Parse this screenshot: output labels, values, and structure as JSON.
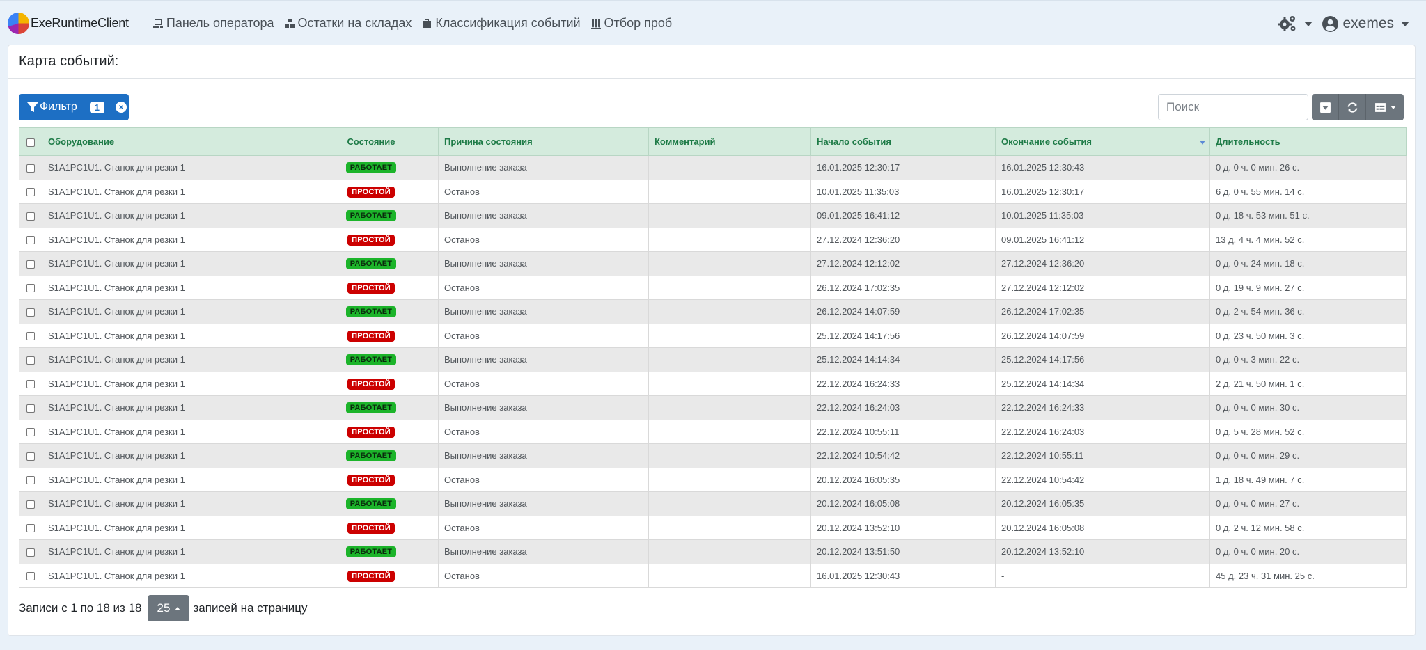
{
  "navbar": {
    "brand": "ExeRuntimeClient",
    "links": [
      {
        "label": "Панель оператора",
        "icon": "operator-panel-icon"
      },
      {
        "label": "Остатки на складах",
        "icon": "warehouse-icon"
      },
      {
        "label": "Классификация событий",
        "icon": "classification-icon"
      },
      {
        "label": "Отбор проб",
        "icon": "sampling-icon"
      }
    ],
    "settings_icon": "gears-icon",
    "user": "exemes"
  },
  "card": {
    "title": "Карта событий:"
  },
  "toolbar": {
    "filter_label": "Фильтр",
    "filter_count": "1",
    "search_placeholder": "Поиск"
  },
  "colors": {
    "primary": "#1d6fc4",
    "secondary": "#6c757d",
    "header_bg": "#d4ebdd",
    "header_text": "#1e7b47",
    "working": "#1cb42a",
    "idle": "#cc0000"
  },
  "table": {
    "columns": [
      "Оборудование",
      "Состояние",
      "Причина состояния",
      "Комментарий",
      "Начало события",
      "Окончание события",
      "Длительность"
    ],
    "rows": [
      {
        "equipment": "S1A1PC1U1. Станок для резки 1",
        "state": "РАБОТАЕТ",
        "reason": "Выполнение заказа",
        "comment": "",
        "start": "16.01.2025 12:30:17",
        "end": "16.01.2025 12:30:43",
        "duration": "0 д. 0 ч. 0 мин. 26 с."
      },
      {
        "equipment": "S1A1PC1U1. Станок для резки 1",
        "state": "ПРОСТОЙ",
        "reason": "Останов",
        "comment": "",
        "start": "10.01.2025 11:35:03",
        "end": "16.01.2025 12:30:17",
        "duration": "6 д. 0 ч. 55 мин. 14 с."
      },
      {
        "equipment": "S1A1PC1U1. Станок для резки 1",
        "state": "РАБОТАЕТ",
        "reason": "Выполнение заказа",
        "comment": "",
        "start": "09.01.2025 16:41:12",
        "end": "10.01.2025 11:35:03",
        "duration": "0 д. 18 ч. 53 мин. 51 с."
      },
      {
        "equipment": "S1A1PC1U1. Станок для резки 1",
        "state": "ПРОСТОЙ",
        "reason": "Останов",
        "comment": "",
        "start": "27.12.2024 12:36:20",
        "end": "09.01.2025 16:41:12",
        "duration": "13 д. 4 ч. 4 мин. 52 с."
      },
      {
        "equipment": "S1A1PC1U1. Станок для резки 1",
        "state": "РАБОТАЕТ",
        "reason": "Выполнение заказа",
        "comment": "",
        "start": "27.12.2024 12:12:02",
        "end": "27.12.2024 12:36:20",
        "duration": "0 д. 0 ч. 24 мин. 18 с."
      },
      {
        "equipment": "S1A1PC1U1. Станок для резки 1",
        "state": "ПРОСТОЙ",
        "reason": "Останов",
        "comment": "",
        "start": "26.12.2024 17:02:35",
        "end": "27.12.2024 12:12:02",
        "duration": "0 д. 19 ч. 9 мин. 27 с."
      },
      {
        "equipment": "S1A1PC1U1. Станок для резки 1",
        "state": "РАБОТАЕТ",
        "reason": "Выполнение заказа",
        "comment": "",
        "start": "26.12.2024 14:07:59",
        "end": "26.12.2024 17:02:35",
        "duration": "0 д. 2 ч. 54 мин. 36 с."
      },
      {
        "equipment": "S1A1PC1U1. Станок для резки 1",
        "state": "ПРОСТОЙ",
        "reason": "Останов",
        "comment": "",
        "start": "25.12.2024 14:17:56",
        "end": "26.12.2024 14:07:59",
        "duration": "0 д. 23 ч. 50 мин. 3 с."
      },
      {
        "equipment": "S1A1PC1U1. Станок для резки 1",
        "state": "РАБОТАЕТ",
        "reason": "Выполнение заказа",
        "comment": "",
        "start": "25.12.2024 14:14:34",
        "end": "25.12.2024 14:17:56",
        "duration": "0 д. 0 ч. 3 мин. 22 с."
      },
      {
        "equipment": "S1A1PC1U1. Станок для резки 1",
        "state": "ПРОСТОЙ",
        "reason": "Останов",
        "comment": "",
        "start": "22.12.2024 16:24:33",
        "end": "25.12.2024 14:14:34",
        "duration": "2 д. 21 ч. 50 мин. 1 с."
      },
      {
        "equipment": "S1A1PC1U1. Станок для резки 1",
        "state": "РАБОТАЕТ",
        "reason": "Выполнение заказа",
        "comment": "",
        "start": "22.12.2024 16:24:03",
        "end": "22.12.2024 16:24:33",
        "duration": "0 д. 0 ч. 0 мин. 30 с."
      },
      {
        "equipment": "S1A1PC1U1. Станок для резки 1",
        "state": "ПРОСТОЙ",
        "reason": "Останов",
        "comment": "",
        "start": "22.12.2024 10:55:11",
        "end": "22.12.2024 16:24:03",
        "duration": "0 д. 5 ч. 28 мин. 52 с."
      },
      {
        "equipment": "S1A1PC1U1. Станок для резки 1",
        "state": "РАБОТАЕТ",
        "reason": "Выполнение заказа",
        "comment": "",
        "start": "22.12.2024 10:54:42",
        "end": "22.12.2024 10:55:11",
        "duration": "0 д. 0 ч. 0 мин. 29 с."
      },
      {
        "equipment": "S1A1PC1U1. Станок для резки 1",
        "state": "ПРОСТОЙ",
        "reason": "Останов",
        "comment": "",
        "start": "20.12.2024 16:05:35",
        "end": "22.12.2024 10:54:42",
        "duration": "1 д. 18 ч. 49 мин. 7 с."
      },
      {
        "equipment": "S1A1PC1U1. Станок для резки 1",
        "state": "РАБОТАЕТ",
        "reason": "Выполнение заказа",
        "comment": "",
        "start": "20.12.2024 16:05:08",
        "end": "20.12.2024 16:05:35",
        "duration": "0 д. 0 ч. 0 мин. 27 с."
      },
      {
        "equipment": "S1A1PC1U1. Станок для резки 1",
        "state": "ПРОСТОЙ",
        "reason": "Останов",
        "comment": "",
        "start": "20.12.2024 13:52:10",
        "end": "20.12.2024 16:05:08",
        "duration": "0 д. 2 ч. 12 мин. 58 с."
      },
      {
        "equipment": "S1A1PC1U1. Станок для резки 1",
        "state": "РАБОТАЕТ",
        "reason": "Выполнение заказа",
        "comment": "",
        "start": "20.12.2024 13:51:50",
        "end": "20.12.2024 13:52:10",
        "duration": "0 д. 0 ч. 0 мин. 20 с."
      },
      {
        "equipment": "S1A1PC1U1. Станок для резки 1",
        "state": "ПРОСТОЙ",
        "reason": "Останов",
        "comment": "",
        "start": "16.01.2025 12:30:43",
        "end": "-",
        "duration": "45 д. 23 ч. 31 мин. 25 с."
      }
    ]
  },
  "footer": {
    "records_text": "Записи с 1 по 18 из 18",
    "page_size": "25",
    "per_page_text": "записей на страницу"
  }
}
